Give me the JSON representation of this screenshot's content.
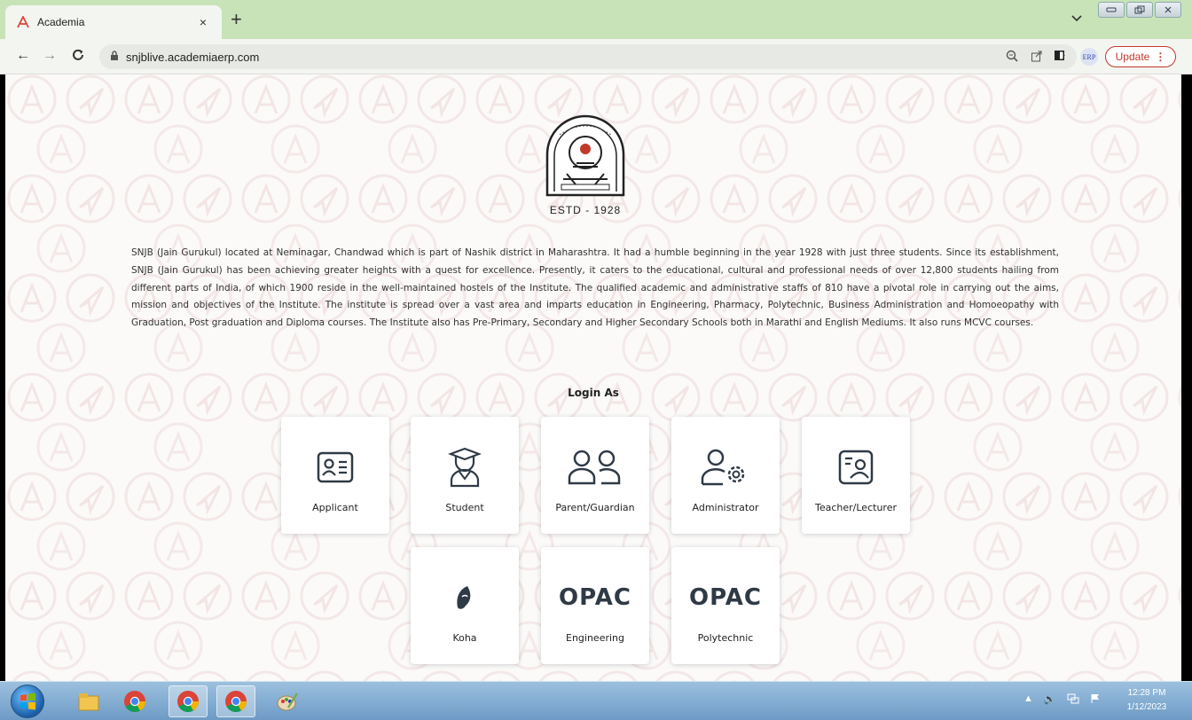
{
  "browser": {
    "tab_title": "Academia",
    "tab_close": "×",
    "new_tab": "+",
    "url": "snjblive.academiaerp.com",
    "extension_badge": "ERP",
    "update_label": "Update",
    "update_menu": "⋮",
    "tab_dropdown": "⌄"
  },
  "page": {
    "estd": "ESTD - 1928",
    "description": "SNJB (Jain Gurukul) located at Neminagar, Chandwad which is part of Nashik district in Maharashtra. It had a humble beginning in the year 1928 with just three students. Since its establishment, SNJB (Jain Gurukul) has been achieving greater heights with a quest for excellence. Presently, it caters to the educational, cultural and professional needs of over 12,800 students hailing from different parts of India, of which 1900 reside in the well-maintained hostels of the Institute.  The qualified academic and administrative staffs of 810 have a pivotal role in carrying out the aims, mission and objectives of the Institute. The institute is spread over a vast area and imparts education in Engineering, Pharmacy, Polytechnic, Business Administration and Homoeopathy with Graduation, Post graduation and Diploma courses. The Institute also has Pre-Primary, Secondary and Higher Secondary Schools both in Marathi and English Mediums. It also runs MCVC courses.",
    "login_heading": "Login As",
    "cards": [
      {
        "label": "Applicant",
        "icon": "id-card-icon"
      },
      {
        "label": "Student",
        "icon": "graduate-icon"
      },
      {
        "label": "Parent/Guardian",
        "icon": "users-icon"
      },
      {
        "label": "Administrator",
        "icon": "user-gear-icon"
      },
      {
        "label": "Teacher/Lecturer",
        "icon": "teacher-board-icon"
      },
      {
        "label": "Koha",
        "icon": "koha-leaf-icon"
      },
      {
        "label": "Engineering",
        "icon_text": "OPAC"
      },
      {
        "label": "Polytechnic",
        "icon_text": "OPAC"
      }
    ]
  },
  "taskbar": {
    "time": "12:28 PM",
    "date": "1/12/2023"
  },
  "colors": {
    "tab_strip": "#c8e3b8",
    "update_red": "#c0392b",
    "icon_dark": "#2f3a46",
    "academia_logo": "#e0433a"
  }
}
